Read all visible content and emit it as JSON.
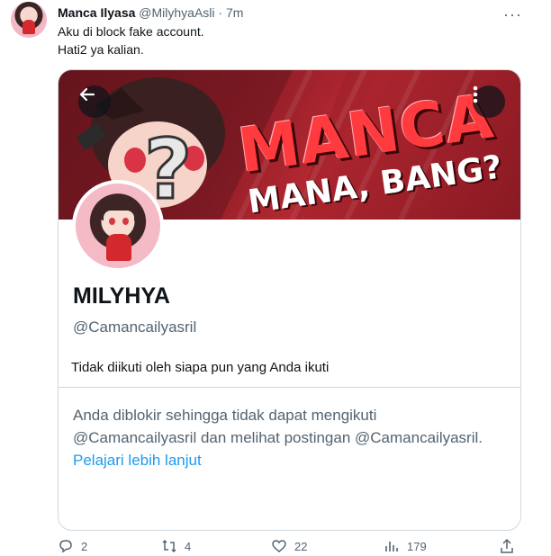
{
  "tweet": {
    "author_name": "Manca Ilyasa",
    "author_handle": "@MilyhyaAsli",
    "separator": "·",
    "time": "7m",
    "more_icon": "more-horizontal-icon",
    "text_lines": [
      "Aku di block fake account.",
      "Hati2 ya kalian."
    ]
  },
  "card": {
    "banner": {
      "title": "MANCA",
      "subtitle": "MANA, BANG?",
      "back_icon": "arrow-left-icon",
      "more_icon": "more-vertical-icon"
    },
    "profile": {
      "name": "MILYHYA",
      "handle": "@Camancailyasril",
      "follow_note": "Tidak diikuti oleh siapa pun yang Anda ikuti"
    },
    "blocked": {
      "text": "Anda diblokir sehingga tidak dapat mengikuti @Camancailyasril dan melihat postingan @Camancailyasril.",
      "link": "Pelajari lebih lanjut"
    }
  },
  "actions": {
    "reply": {
      "icon": "reply-icon",
      "count": "2"
    },
    "retweet": {
      "icon": "retweet-icon",
      "count": "4"
    },
    "like": {
      "icon": "heart-icon",
      "count": "22"
    },
    "views": {
      "icon": "views-icon",
      "count": "179"
    },
    "share": {
      "icon": "share-icon"
    }
  },
  "colors": {
    "accent": "#1d9bf0",
    "secondary_text": "#536471",
    "banner_red": "#b82a33"
  }
}
